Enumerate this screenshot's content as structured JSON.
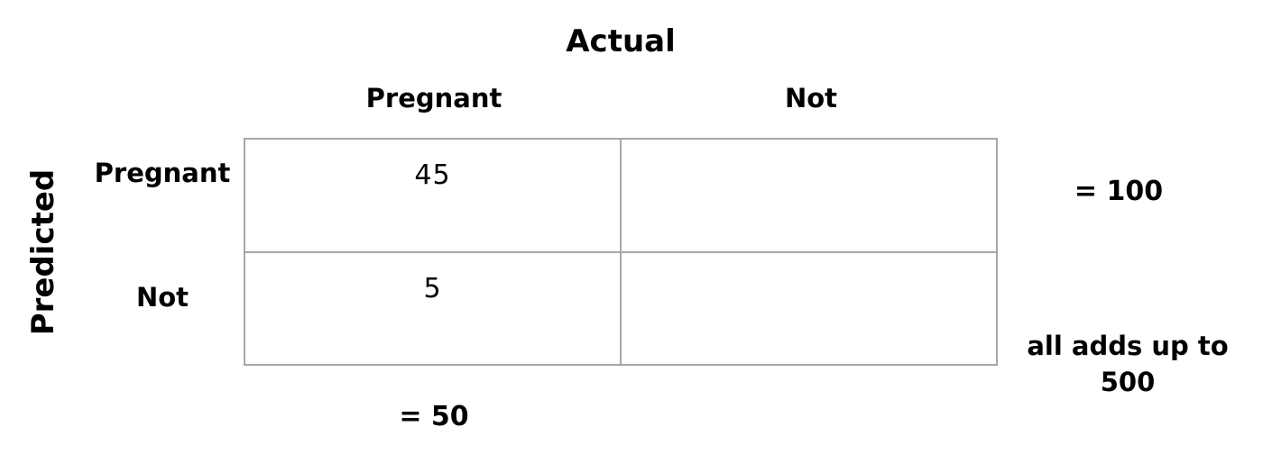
{
  "title": "Actual",
  "axis_label": "Predicted",
  "columns": [
    "Pregnant",
    "Not"
  ],
  "rows": [
    "Pregnant",
    "Not"
  ],
  "cells": [
    [
      "45",
      ""
    ],
    [
      "5",
      ""
    ]
  ],
  "row_total": "= 100",
  "col_total": "= 50",
  "grand_total": "all adds up to 500",
  "colors": {
    "grid_line": "#a6a6a6",
    "text": "#000000",
    "background": "#ffffff"
  }
}
